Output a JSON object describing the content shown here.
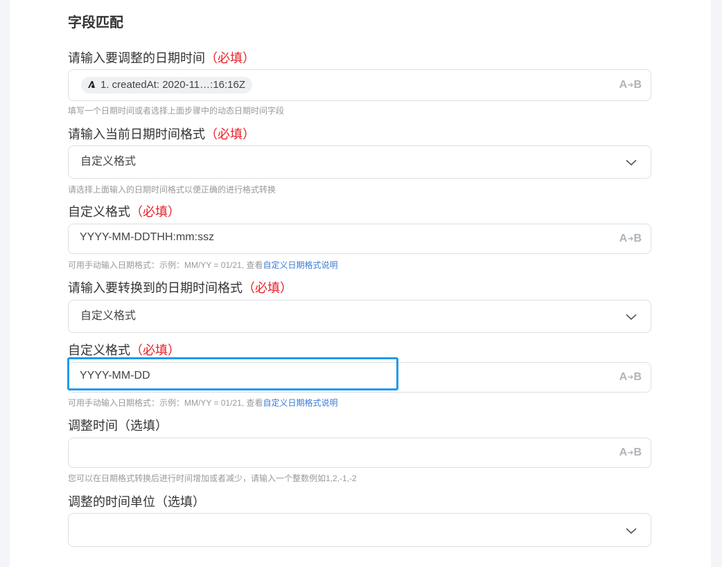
{
  "section": {
    "title": "字段匹配"
  },
  "fields": {
    "date_input": {
      "label": "请输入要调整的日期时间",
      "required": "（必填）",
      "chip_text": "1. createdAt: 2020-11…:16:16Z",
      "hint": "填写一个日期时间或者选择上面步骤中的动态日期时间字段"
    },
    "current_format": {
      "label": "请输入当前日期时间格式",
      "required": "（必填）",
      "value": "自定义格式",
      "hint": "请选择上面输入的日期时间格式以便正确的进行格式转换"
    },
    "custom_format_1": {
      "label": "自定义格式",
      "required": "（必填）",
      "value": "YYYY-MM-DDTHH:mm:ssz",
      "hint_prefix": "可用手动输入日期格式：示例：MM/YY = 01/21, 查看",
      "hint_link": "自定义日期格式说明"
    },
    "target_format": {
      "label": "请输入要转换到的日期时间格式",
      "required": "（必填）",
      "value": "自定义格式"
    },
    "custom_format_2": {
      "label": "自定义格式",
      "required": "（必填）",
      "value": "YYYY-MM-DD",
      "hint_prefix": "可用手动输入日期格式：示例：MM/YY = 01/21, 查看",
      "hint_link": "自定义日期格式说明"
    },
    "adjust_time": {
      "label": "调整时间（选填）",
      "value": "",
      "hint": "您可以在日期格式转换后进行时间增加或者减少，请输入一个整数例如1,2,-1,-2"
    },
    "time_unit": {
      "label": "调整的时间单位（选填）",
      "value": ""
    }
  },
  "icons": {
    "text_mode": "A▸B",
    "text_mode_icon": "a-to-b-icon",
    "dropdown_icon": "chevron-down-icon",
    "chip_icon": "app-logo-icon"
  },
  "colors": {
    "required": "#e8202a",
    "link": "#3a7bd5",
    "focus": "#1e9af0"
  }
}
